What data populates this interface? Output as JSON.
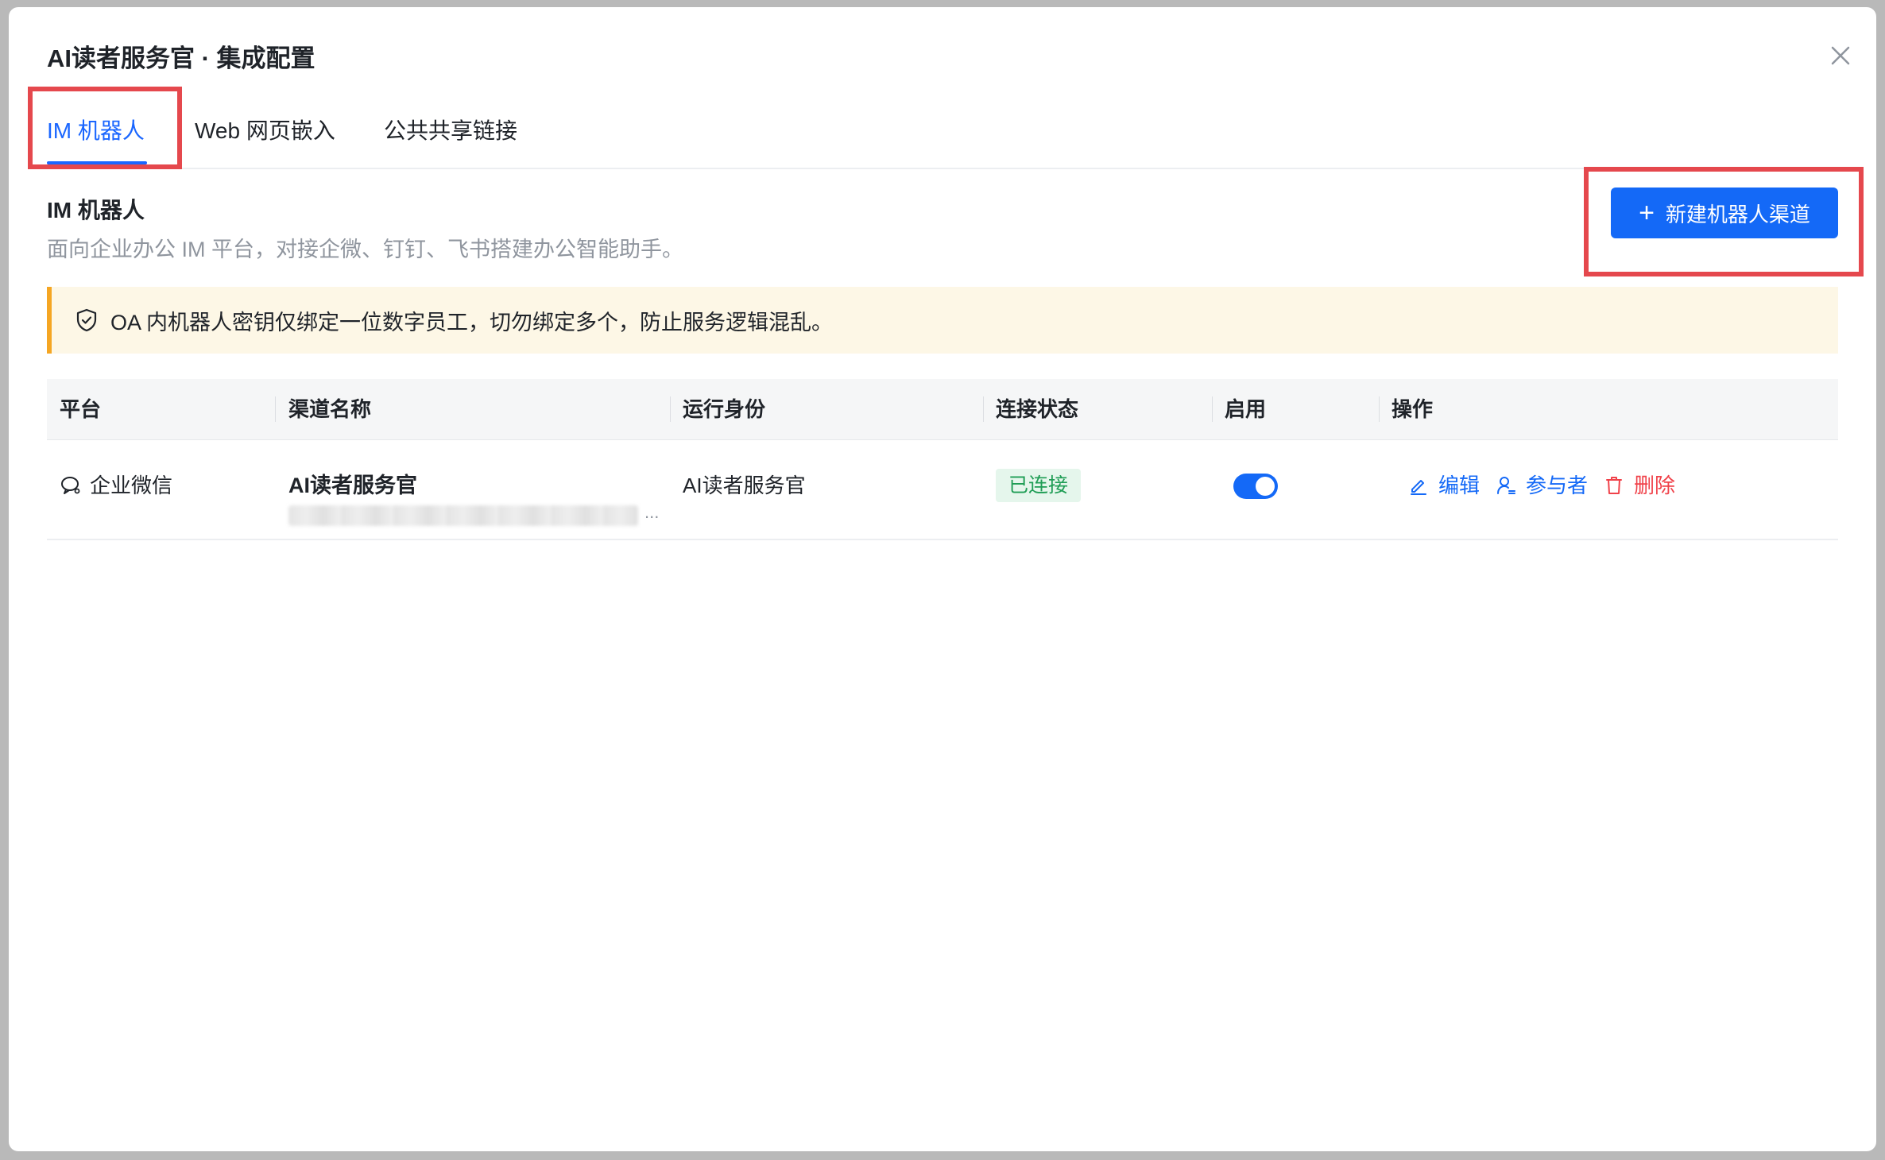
{
  "modal": {
    "title": "AI读者服务官 · 集成配置"
  },
  "tabs": [
    {
      "label": "IM 机器人",
      "active": true
    },
    {
      "label": "Web 网页嵌入",
      "active": false
    },
    {
      "label": "公共共享链接",
      "active": false
    }
  ],
  "section": {
    "title": "IM 机器人",
    "description": "面向企业办公 IM 平台，对接企微、钉钉、飞书搭建办公智能助手。",
    "new_button_label": "新建机器人渠道"
  },
  "alert": {
    "text": "OA 内机器人密钥仅绑定一位数字员工，切勿绑定多个，防止服务逻辑混乱。",
    "icon": "shield-check-icon"
  },
  "table": {
    "headers": [
      "平台",
      "渠道名称",
      "运行身份",
      "连接状态",
      "启用",
      "操作"
    ],
    "rows": [
      {
        "platform": "企业微信",
        "channel_name": "AI读者服务官",
        "channel_id_suffix": "...",
        "identity": "AI读者服务官",
        "status": "已连接",
        "enabled": true,
        "actions": {
          "edit": "编辑",
          "participants": "参与者",
          "delete": "删除"
        }
      }
    ]
  },
  "colors": {
    "primary": "#1469f7",
    "danger": "#f0424a",
    "success": "#1f9d55",
    "warning_border": "#f5a623",
    "highlight": "#e5484d"
  }
}
